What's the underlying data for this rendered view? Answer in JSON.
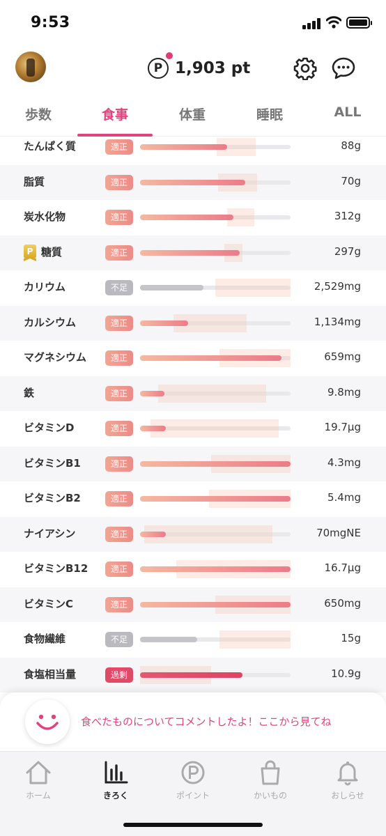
{
  "status_bar": {
    "time": "9:53"
  },
  "header": {
    "points_icon": "P",
    "points_value": "1,903 pt"
  },
  "tabs": [
    {
      "label": "歩数",
      "active": false
    },
    {
      "label": "食事",
      "active": true
    },
    {
      "label": "体重",
      "active": false
    },
    {
      "label": "睡眠",
      "active": false
    },
    {
      "label": "ALL",
      "active": false
    }
  ],
  "nutrients": [
    {
      "name": "たんぱく質",
      "status": "適正",
      "level": "ok",
      "amount": "88g",
      "fill": 0.58,
      "target": [
        0.51,
        0.77
      ]
    },
    {
      "name": "脂質",
      "status": "適正",
      "level": "ok",
      "amount": "70g",
      "fill": 0.7,
      "target": [
        0.52,
        0.78
      ]
    },
    {
      "name": "炭水化物",
      "status": "適正",
      "level": "ok",
      "amount": "312g",
      "fill": 0.62,
      "target": [
        0.58,
        0.76
      ]
    },
    {
      "name": "糖質",
      "status": "適正",
      "level": "ok",
      "amount": "297g",
      "fill": 0.66,
      "target": [
        0.56,
        0.68
      ],
      "points_badge": "P"
    },
    {
      "name": "カリウム",
      "status": "不足",
      "level": "low",
      "amount": "2,529mg",
      "fill": 0.42,
      "target": [
        0.5,
        1.0
      ]
    },
    {
      "name": "カルシウム",
      "status": "適正",
      "level": "ok",
      "amount": "1,134mg",
      "fill": 0.32,
      "target": [
        0.22,
        0.71
      ]
    },
    {
      "name": "マグネシウム",
      "status": "適正",
      "level": "ok",
      "amount": "659mg",
      "fill": 0.94,
      "target": [
        0.53,
        1.0
      ]
    },
    {
      "name": "鉄",
      "status": "適正",
      "level": "ok",
      "amount": "9.8mg",
      "fill": 0.16,
      "target": [
        0.12,
        0.84
      ]
    },
    {
      "name": "ビタミンD",
      "status": "適正",
      "level": "ok",
      "amount": "19.7µg",
      "fill": 0.17,
      "target": [
        0.07,
        0.92
      ]
    },
    {
      "name": "ビタミンB1",
      "status": "適正",
      "level": "ok",
      "amount": "4.3mg",
      "fill": 1.0,
      "target": [
        0.47,
        1.0
      ]
    },
    {
      "name": "ビタミンB2",
      "status": "適正",
      "level": "ok",
      "amount": "5.4mg",
      "fill": 1.0,
      "target": [
        0.46,
        1.0
      ]
    },
    {
      "name": "ナイアシン",
      "status": "適正",
      "level": "ok",
      "amount": "70mgNE",
      "fill": 0.17,
      "target": [
        0.03,
        0.88
      ]
    },
    {
      "name": "ビタミンB12",
      "status": "適正",
      "level": "ok",
      "amount": "16.7µg",
      "fill": 1.0,
      "target": [
        0.24,
        1.0
      ]
    },
    {
      "name": "ビタミンC",
      "status": "適正",
      "level": "ok",
      "amount": "650mg",
      "fill": 1.0,
      "target": [
        0.5,
        1.0
      ]
    },
    {
      "name": "食物繊維",
      "status": "不足",
      "level": "low",
      "amount": "15g",
      "fill": 0.38,
      "target": [
        0.53,
        1.0
      ]
    },
    {
      "name": "食塩相当量",
      "status": "過剰",
      "level": "over",
      "amount": "10.9g",
      "fill": 0.68,
      "target": [
        0.0,
        0.47
      ]
    }
  ],
  "banner": {
    "text": "食べたものについてコメントしたよ！ここから見てね"
  },
  "bottom_nav": [
    {
      "label": "ホーム",
      "icon": "home-icon",
      "active": false
    },
    {
      "label": "きろく",
      "icon": "chart-icon",
      "active": true
    },
    {
      "label": "ポイント",
      "icon": "point-icon",
      "active": false
    },
    {
      "label": "かいもの",
      "icon": "shopping-bag-icon",
      "active": false
    },
    {
      "label": "おしらせ",
      "icon": "bell-icon",
      "active": false
    }
  ],
  "colors": {
    "accent": "#e0437e",
    "status_ok": "#ec8b86",
    "status_low": "#b9b9bf",
    "status_over": "#df4a67"
  }
}
